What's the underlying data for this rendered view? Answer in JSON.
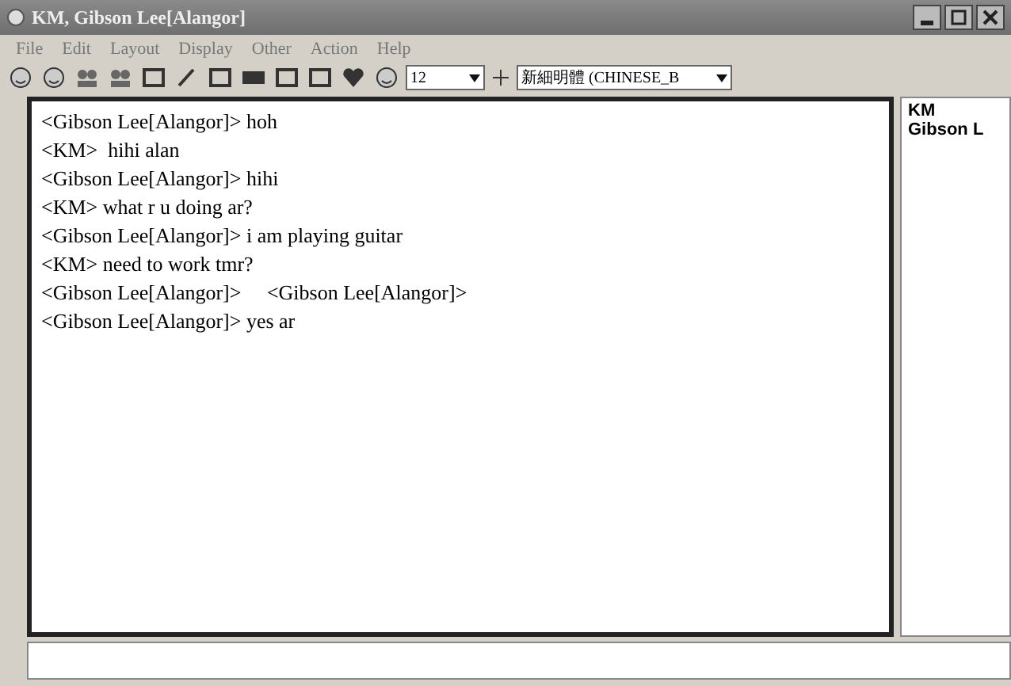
{
  "window": {
    "title": "KM, Gibson Lee[Alangor]"
  },
  "menu": [
    "File",
    "Edit",
    "Layout",
    "Display",
    "Other",
    "Action",
    "Help"
  ],
  "toolbar": {
    "font_size": "12",
    "font_name": "新細明體 (CHINESE_B"
  },
  "messages": [
    {
      "text": "<Gibson Lee[Alangor]> hoh"
    },
    {
      "text": "<KM>  hihi alan"
    },
    {
      "text": "<Gibson Lee[Alangor]> hihi"
    },
    {
      "text": "<KM> what r u doing ar?"
    },
    {
      "text": "<Gibson Lee[Alangor]> i am playing guitar"
    },
    {
      "text": "<KM> need to work tmr?"
    },
    {
      "text": "<Gibson Lee[Alangor]>     <Gibson Lee[Alangor]>"
    },
    {
      "text": "<Gibson Lee[Alangor]> yes ar"
    }
  ],
  "participants": [
    "KM",
    "Gibson L"
  ]
}
